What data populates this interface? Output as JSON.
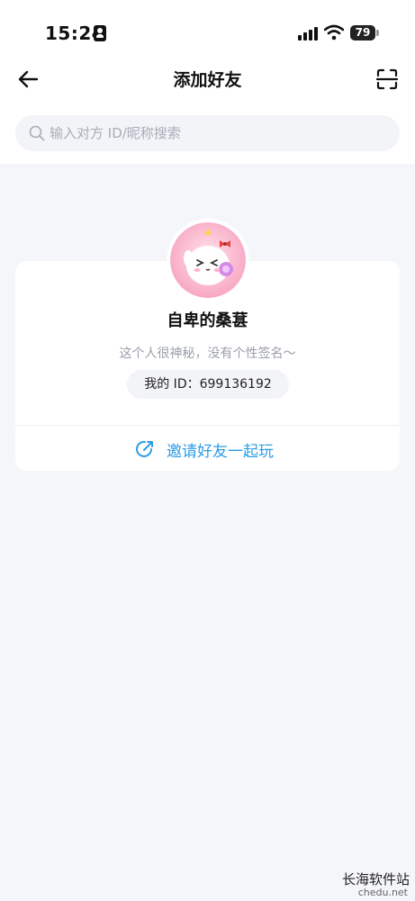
{
  "status_bar": {
    "time": "15:24",
    "battery": "79"
  },
  "nav": {
    "title": "添加好友"
  },
  "search": {
    "placeholder": "输入对方 ID/昵称搜索"
  },
  "profile": {
    "nickname": "自卑的桑葚",
    "signature": "这个人很神秘，没有个性签名～",
    "id_text": "我的 ID：699136192"
  },
  "invite": {
    "label": "邀请好友一起玩"
  },
  "watermark": {
    "main": "长海软件站",
    "sub": "chedu.net"
  },
  "colors": {
    "accent": "#2e9de6",
    "background": "#f5f6fa",
    "card": "#ffffff"
  }
}
